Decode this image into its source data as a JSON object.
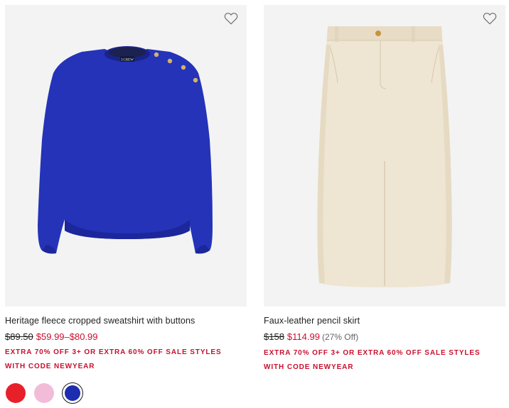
{
  "products": [
    {
      "name": "Heritage fleece cropped sweatshirt with buttons",
      "price_original": "$89.50",
      "price_sale": "$59.99–$80.99",
      "promo": "EXTRA 70% OFF 3+ OR EXTRA 60% OFF SALE STYLES WITH CODE NEWYEAR",
      "image_logo_text": "J.CREW",
      "swatches": [
        {
          "color": "#e8202a",
          "name": "red",
          "selected": false
        },
        {
          "color": "#f2bcd9",
          "name": "pink",
          "selected": false
        },
        {
          "color": "#1c2db0",
          "name": "royal-blue",
          "selected": true
        }
      ]
    },
    {
      "name": "Faux-leather pencil skirt",
      "price_original": "$158",
      "price_sale": "$114.99",
      "price_off": "(27% Off)",
      "promo": "EXTRA 70% OFF 3+ OR EXTRA 60% OFF SALE STYLES WITH CODE NEWYEAR"
    }
  ],
  "colors": {
    "sale_red": "#c8102e",
    "image_bg": "#f3f3f3",
    "sweatshirt_blue": "#2433b8",
    "skirt_cream": "#efe5d3"
  },
  "icons": {
    "wishlist": "heart-outline-icon"
  }
}
